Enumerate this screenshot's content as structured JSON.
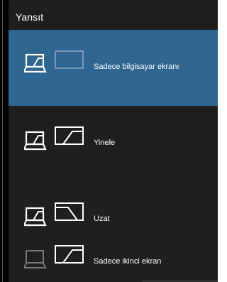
{
  "panel": {
    "title": "Yansıt"
  },
  "options": [
    {
      "label": "Sadece bilgisayar ekranı",
      "selected": true,
      "icon": "pc-screen-only-icon"
    },
    {
      "label": "Yinele",
      "selected": false,
      "icon": "duplicate-icon"
    },
    {
      "label": "Uzat",
      "selected": false,
      "icon": "extend-icon"
    },
    {
      "label": "Sadece ikinci ekran",
      "selected": false,
      "icon": "second-screen-only-icon"
    }
  ],
  "colors": {
    "panel_bg": "#1f1f1f",
    "selected_bg": "#2f6591",
    "icon_active": "#ffffff",
    "icon_dim": "#777777"
  }
}
